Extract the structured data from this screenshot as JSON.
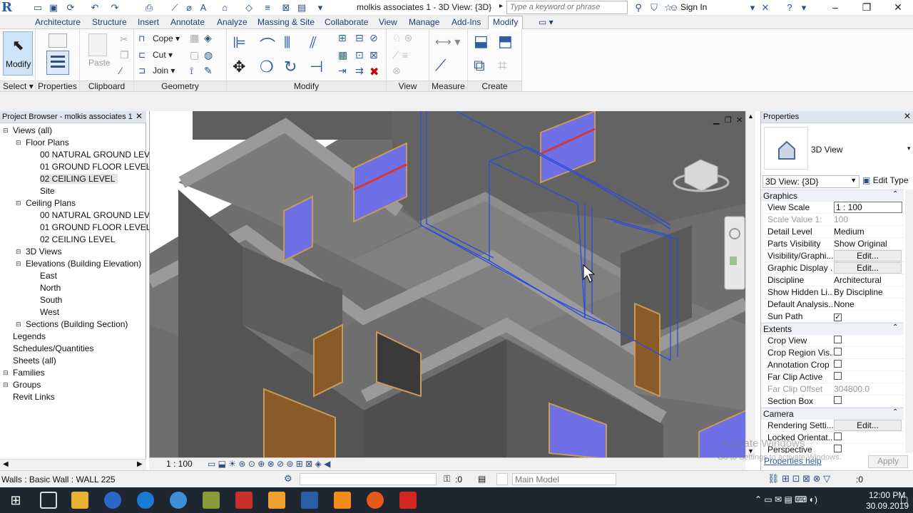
{
  "titlebar": {
    "document_title": "molkis associates 1 - 3D View: {3D}",
    "search_placeholder": "Type a keyword or phrase",
    "signin_label": "Sign In",
    "app_logo": "R"
  },
  "ribbon": {
    "tabs": [
      "Architecture",
      "Structure",
      "Insert",
      "Annotate",
      "Analyze",
      "Massing & Site",
      "Collaborate",
      "View",
      "Manage",
      "Add-Ins",
      "Modify"
    ],
    "active_tab": "Modify",
    "panels": {
      "select": "Select",
      "properties": "Properties",
      "clipboard": "Clipboard",
      "geometry": "Geometry",
      "modify": "Modify",
      "view": "View",
      "measure": "Measure",
      "create": "Create"
    },
    "modify_button": "Modify",
    "paste_label": "Paste",
    "cope_label": "Cope",
    "cut_label": "Cut",
    "join_label": "Join"
  },
  "project_browser": {
    "title": "Project Browser - molkis associates 1",
    "items": [
      {
        "label": "Views (all)",
        "level": 0,
        "toggle": "−"
      },
      {
        "label": "Floor Plans",
        "level": 1,
        "toggle": "−"
      },
      {
        "label": "00 NATURAL GROUND LEVLI",
        "level": 2,
        "toggle": ""
      },
      {
        "label": "01 GROUND FLOOR LEVEL",
        "level": 2,
        "toggle": ""
      },
      {
        "label": "02 CEILING LEVEL",
        "level": 2,
        "toggle": "",
        "selected": true
      },
      {
        "label": "Site",
        "level": 2,
        "toggle": ""
      },
      {
        "label": "Ceiling Plans",
        "level": 1,
        "toggle": "−"
      },
      {
        "label": "00 NATURAL GROUND LEVLI",
        "level": 2,
        "toggle": ""
      },
      {
        "label": "01 GROUND FLOOR LEVEL",
        "level": 2,
        "toggle": ""
      },
      {
        "label": "02 CEILING LEVEL",
        "level": 2,
        "toggle": ""
      },
      {
        "label": "3D Views",
        "level": 1,
        "toggle": "+"
      },
      {
        "label": "Elevations (Building Elevation)",
        "level": 1,
        "toggle": "−"
      },
      {
        "label": "East",
        "level": 2,
        "toggle": ""
      },
      {
        "label": "North",
        "level": 2,
        "toggle": ""
      },
      {
        "label": "South",
        "level": 2,
        "toggle": ""
      },
      {
        "label": "West",
        "level": 2,
        "toggle": ""
      },
      {
        "label": "Sections (Building Section)",
        "level": 1,
        "toggle": "+"
      },
      {
        "label": "Legends",
        "level": 0,
        "toggle": ""
      },
      {
        "label": "Schedules/Quantities",
        "level": 0,
        "toggle": ""
      },
      {
        "label": "Sheets (all)",
        "level": 0,
        "toggle": ""
      },
      {
        "label": "Families",
        "level": 0,
        "toggle": "+"
      },
      {
        "label": "Groups",
        "level": 0,
        "toggle": "+"
      },
      {
        "label": "Revit Links",
        "level": 0,
        "toggle": ""
      }
    ]
  },
  "viewport": {
    "scale": "1 : 100"
  },
  "properties": {
    "title": "Properties",
    "type_name": "3D View",
    "selector": "3D View: {3D}",
    "edit_type": "Edit Type",
    "groups": [
      {
        "name": "Graphics",
        "rows": [
          {
            "label": "View Scale",
            "value": "1 : 100",
            "kind": "input"
          },
          {
            "label": "Scale Value    1:",
            "value": "100",
            "kind": "muted"
          },
          {
            "label": "Detail Level",
            "value": "Medium",
            "kind": "text"
          },
          {
            "label": "Parts Visibility",
            "value": "Show Original",
            "kind": "text"
          },
          {
            "label": "Visibility/Graphi...",
            "value": "Edit...",
            "kind": "button"
          },
          {
            "label": "Graphic Display ...",
            "value": "Edit...",
            "kind": "button"
          },
          {
            "label": "Discipline",
            "value": "Architectural",
            "kind": "text"
          },
          {
            "label": "Show Hidden Li...",
            "value": "By Discipline",
            "kind": "text"
          },
          {
            "label": "Default Analysis...",
            "value": "None",
            "kind": "text"
          },
          {
            "label": "Sun Path",
            "value": "✓",
            "kind": "check"
          }
        ]
      },
      {
        "name": "Extents",
        "rows": [
          {
            "label": "Crop View",
            "value": "",
            "kind": "check"
          },
          {
            "label": "Crop Region Vis...",
            "value": "",
            "kind": "check"
          },
          {
            "label": "Annotation Crop",
            "value": "",
            "kind": "check"
          },
          {
            "label": "Far Clip Active",
            "value": "",
            "kind": "check"
          },
          {
            "label": "Far Clip Offset",
            "value": "304800.0",
            "kind": "muted"
          },
          {
            "label": "Section Box",
            "value": "",
            "kind": "check"
          }
        ]
      },
      {
        "name": "Camera",
        "rows": [
          {
            "label": "Rendering Setti...",
            "value": "Edit...",
            "kind": "button"
          },
          {
            "label": "Locked Orientat...",
            "value": "",
            "kind": "check"
          },
          {
            "label": "Perspective",
            "value": "",
            "kind": "check"
          }
        ]
      }
    ],
    "help_link": "Properties help",
    "apply": "Apply"
  },
  "statusbar": {
    "message": "Walls : Basic Wall : WALL 225",
    "zero": ":0",
    "model": "Main Model",
    "filter_count": ":0"
  },
  "watermark": {
    "line1": "Activate Windows",
    "line2": "Go to Settings to activate Windows."
  },
  "taskbar": {
    "time": "12:00 PM",
    "date": "30.09.2019"
  }
}
